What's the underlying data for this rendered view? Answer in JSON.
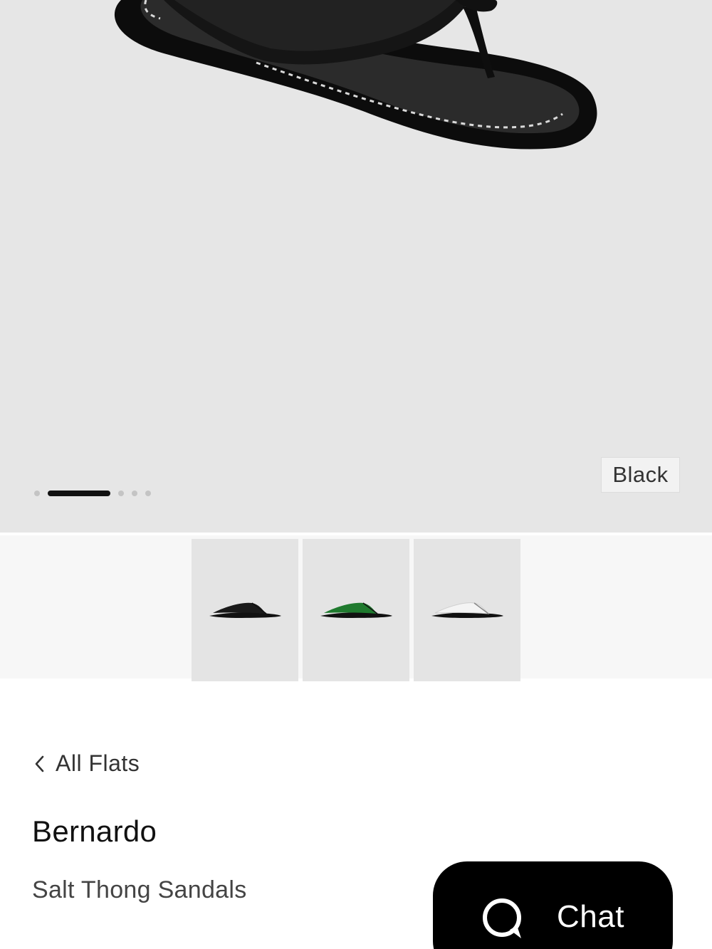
{
  "product_gallery": {
    "selected_color": "Black",
    "slide_count": 5,
    "active_slide": 1
  },
  "thumbnails": [
    {
      "color_name": "black",
      "color": "#1a1a1a"
    },
    {
      "color_name": "green",
      "color": "#1f7a2e"
    },
    {
      "color_name": "white",
      "color": "#f4f4f4"
    }
  ],
  "breadcrumb": {
    "back_label": "All Flats",
    "icon": "chevron-left-icon"
  },
  "product": {
    "brand": "Bernardo",
    "name": "Salt Thong Sandals"
  },
  "chat": {
    "label": "Chat",
    "icon": "chat-bubble-icon"
  },
  "colors": {
    "hero_background": "#e6e6e6",
    "thumb_background": "#e4e4e4",
    "chat_button": "#000000"
  }
}
